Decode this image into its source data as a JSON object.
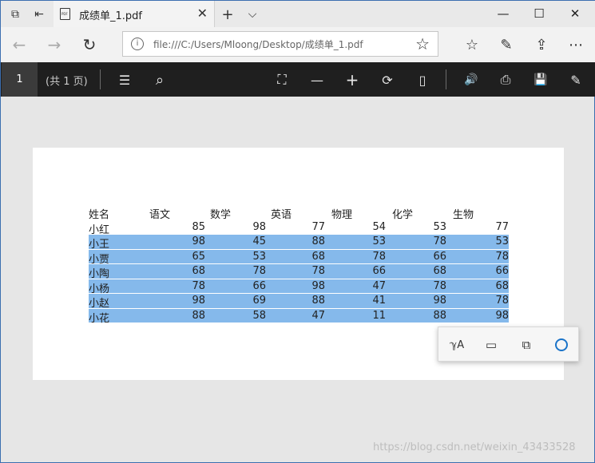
{
  "tab": {
    "title": "成绩单_1.pdf",
    "close": "✕",
    "new_tab": "+",
    "dropdown": "⌵"
  },
  "window": {
    "minimize": "—",
    "maximize": "☐",
    "close": "✕"
  },
  "nav": {
    "back": "←",
    "forward": "→",
    "refresh": "↻"
  },
  "address": {
    "info": "i",
    "url": "file:///C:/Users/Mloong/Desktop/成绩单_1.pdf",
    "favorite": "☆"
  },
  "browser_tools": {
    "favorites": "☆",
    "notes": "✎",
    "share": "⇪",
    "more": "⋯"
  },
  "pdf_toolbar": {
    "page_number": "1",
    "page_count": "(共 1 页)",
    "icons": {
      "contents": "☰",
      "search": "⌕",
      "fit": "⛶",
      "zoom_out": "—",
      "zoom_in": "+",
      "rotate": "⟳",
      "layout": "▯",
      "read_aloud": "🔊",
      "print": "⎙",
      "save": "💾",
      "save_as": "✎"
    }
  },
  "table": {
    "headers": [
      "姓名",
      "语文",
      "数学",
      "英语",
      "物理",
      "化学",
      "生物"
    ],
    "rows": [
      {
        "name": "小红",
        "scores": [
          "85",
          "98",
          "77",
          "54",
          "53",
          "77"
        ],
        "selected": false
      },
      {
        "name": "小王",
        "scores": [
          "98",
          "45",
          "88",
          "53",
          "78",
          "53"
        ],
        "selected": true
      },
      {
        "name": "小贾",
        "scores": [
          "65",
          "53",
          "68",
          "78",
          "66",
          "78"
        ],
        "selected": true
      },
      {
        "name": "小陶",
        "scores": [
          "68",
          "78",
          "78",
          "66",
          "68",
          "66"
        ],
        "selected": true
      },
      {
        "name": "小杨",
        "scores": [
          "78",
          "66",
          "98",
          "47",
          "78",
          "68"
        ],
        "selected": true
      },
      {
        "name": "小赵",
        "scores": [
          "98",
          "69",
          "88",
          "41",
          "98",
          "78"
        ],
        "selected": true
      },
      {
        "name": "小花",
        "scores": [
          "88",
          "58",
          "47",
          "11",
          "88",
          "98"
        ],
        "selected": true
      }
    ]
  },
  "selection_menu": {
    "highlight": "ℽA",
    "comment": "▭",
    "copy": "⧉"
  },
  "watermark": "https://blog.csdn.net/weixin_43433528",
  "colors": {
    "selection": "#85b9eb",
    "pdf_toolbar": "#1f1f1f",
    "cortana": "#1a73c8"
  }
}
